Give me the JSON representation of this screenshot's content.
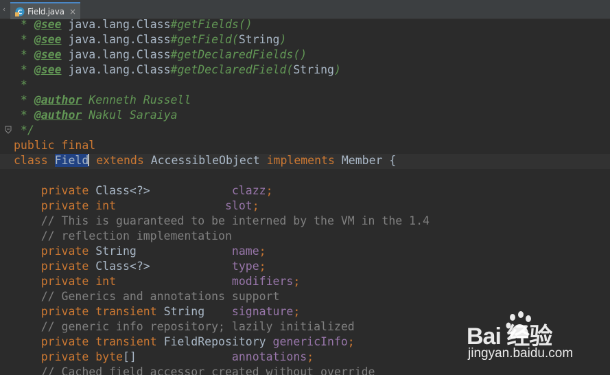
{
  "tab": {
    "filename": "Field.java",
    "close_glyph": "×",
    "scroll_glyph": "‹"
  },
  "code": {
    "l1": {
      "star": " * ",
      "tag": "@see",
      "ref": " java.lang.Class",
      "member": "#getFields()"
    },
    "l2": {
      "star": " * ",
      "tag": "@see",
      "ref": " java.lang.Class",
      "member": "#getField(",
      "arg": "String",
      "close": ")"
    },
    "l3": {
      "star": " * ",
      "tag": "@see",
      "ref": " java.lang.Class",
      "member": "#getDeclaredFields()"
    },
    "l4": {
      "star": " * ",
      "tag": "@see",
      "ref": " java.lang.Class",
      "member": "#getDeclaredField(",
      "arg": "String",
      "close": ")"
    },
    "l5": {
      "star": " *"
    },
    "l6": {
      "star": " * ",
      "tag": "@author",
      "text": " Kenneth Russell"
    },
    "l7": {
      "star": " * ",
      "tag": "@author",
      "text": " Nakul Saraiya"
    },
    "l8": {
      "text": " */"
    },
    "l9": {
      "kw": "public final"
    },
    "l10": {
      "kw1": "class ",
      "sel": "Field",
      "kw2": " extends ",
      "t1": "AccessibleObject ",
      "kw3": "implements ",
      "t2": "Member {"
    },
    "l12": {
      "indent": "    ",
      "kw": "private ",
      "type": "Class<?>           ",
      "field": " clazz",
      "semi": ";"
    },
    "l13": {
      "indent": "    ",
      "kw": "private int",
      "pad": "                ",
      "field": "slot",
      "semi": ";"
    },
    "l14": {
      "text": "    // This is guaranteed to be interned by the VM in the 1.4"
    },
    "l15": {
      "text": "    // reflection implementation"
    },
    "l16": {
      "indent": "    ",
      "kw": "private ",
      "type": "String              ",
      "field": "name",
      "semi": ";"
    },
    "l17": {
      "indent": "    ",
      "kw": "private ",
      "type": "Class<?>            ",
      "field": "type",
      "semi": ";"
    },
    "l18": {
      "indent": "    ",
      "kw": "private int",
      "pad": "                 ",
      "field": "modifiers",
      "semi": ";"
    },
    "l19": {
      "text": "    // Generics and annotations support"
    },
    "l20": {
      "indent": "    ",
      "kw": "private transient ",
      "type": "String    ",
      "field": "signature",
      "semi": ";"
    },
    "l21": {
      "text": "    // generic info repository; lazily initialized"
    },
    "l22": {
      "indent": "    ",
      "kw": "private transient ",
      "type": "FieldRepository ",
      "field": "genericInfo",
      "semi": ";"
    },
    "l23": {
      "indent": "    ",
      "kw": "private byte",
      "type": "[]",
      "pad": "              ",
      "field": "annotations",
      "semi": ";"
    },
    "l24": {
      "text": "    // Cached field accessor created without override"
    }
  },
  "watermark": {
    "brand": "Bai  经验",
    "url": "jingyan.baidu.com"
  },
  "colors": {
    "background": "#2b2b2b",
    "keyword": "#cc7832",
    "javadoc": "#629755",
    "field": "#9876aa",
    "comment": "#808080",
    "plain": "#a9b7c6",
    "selection": "#214283"
  }
}
